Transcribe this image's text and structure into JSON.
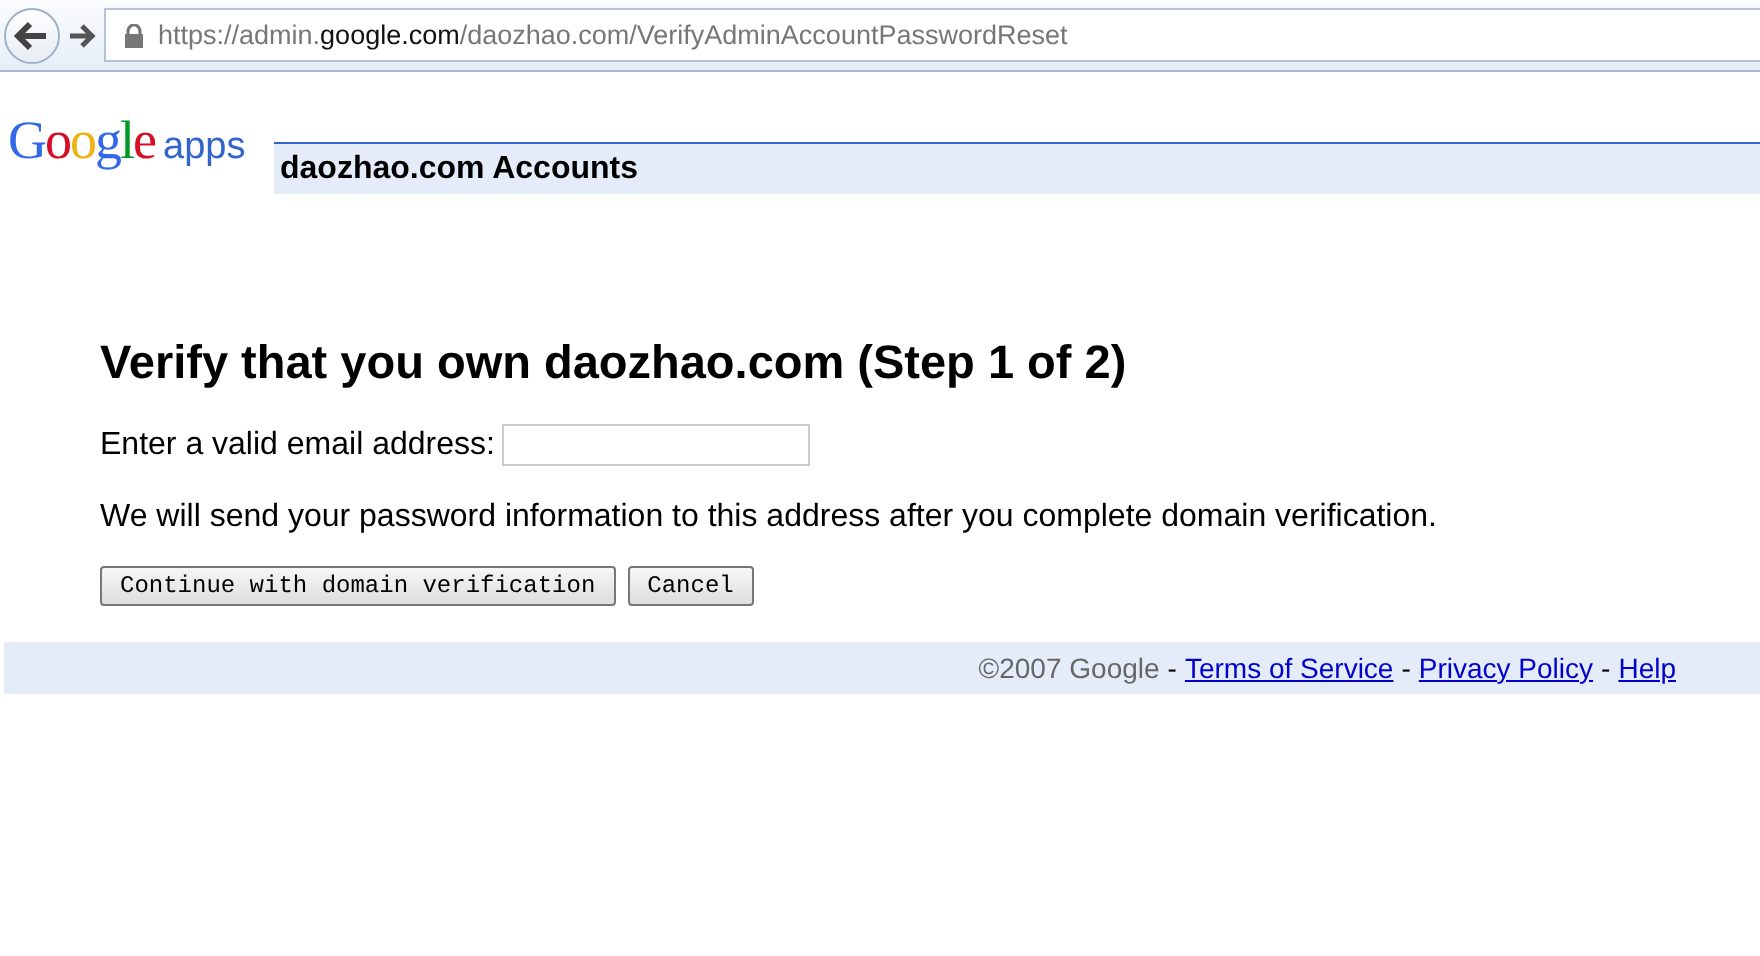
{
  "browser": {
    "url": "https://admin.**google.com**/daozhao.com/VerifyAdminAccountPasswordReset"
  },
  "header": {
    "logo": "Google",
    "logo_suffix": "apps",
    "title": "daozhao.com Accounts"
  },
  "form": {
    "heading": "Verify that you own daozhao.com (Step 1 of 2)",
    "email_label": "Enter a valid email address:",
    "note": "We will send your password information to this address after you complete domain verification.",
    "buttons": [
      "Continue with domain verification",
      "Cancel"
    ]
  },
  "footer": {
    "copyright": "©2007 Google",
    "separator": "-",
    "links": [
      "Terms of Service",
      "Privacy Policy",
      "Help"
    ]
  }
}
